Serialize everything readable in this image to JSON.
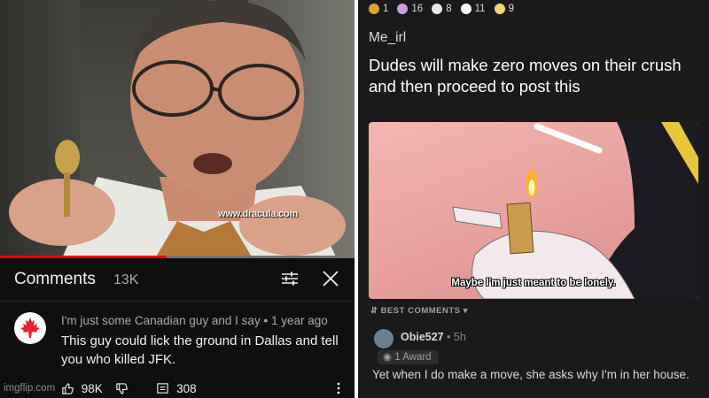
{
  "youtube": {
    "watermark": "www.dracula.com",
    "progress_fraction": 0.47,
    "comments_title": "Comments",
    "comments_count": "13K",
    "comment": {
      "author": "I'm just some Canadian guy and I say",
      "time": "1 year ago",
      "meta_separator": "•",
      "text": "This guy could lick the ground in Dallas and tell you who killed JFK.",
      "likes": "98K",
      "replies": "308"
    },
    "site_watermark": "imgflip.com",
    "icons": {
      "filter": "filter-icon",
      "close": "close-icon",
      "like": "thumbs-up-icon",
      "dislike": "thumbs-down-icon",
      "reply": "reply-icon",
      "more": "more-vert-icon",
      "avatar": "maple-leaf-icon"
    }
  },
  "reddit": {
    "awards": [
      {
        "icon": "award-gold-icon",
        "count": "1",
        "color": "#d9a530"
      },
      {
        "icon": "award-wholesome-icon",
        "count": "16",
        "color": "#c9a0dc"
      },
      {
        "icon": "award-helpful-icon",
        "count": "8",
        "color": "#e8e8e8"
      },
      {
        "icon": "award-silver-icon",
        "count": "11",
        "color": "#ffffff"
      },
      {
        "icon": "award-hugz-icon",
        "count": "9",
        "color": "#f5d76e"
      }
    ],
    "subreddit": "Me_irl",
    "title": "Dudes will make zero moves on their crush and then proceed to post this",
    "image_caption": "Maybe I'm just meant to be lonely.",
    "sort_label": "BEST COMMENTS",
    "comment": {
      "user": "Obie527",
      "time": "5h",
      "meta_separator": "•",
      "award_label": "1 Award",
      "text": "Yet when I do make a move, she asks why I'm in her house."
    }
  },
  "colors": {
    "youtube_bg": "#0f0f0f",
    "reddit_bg": "#1a1a1b",
    "progress_red": "#ff0000",
    "canada_red": "#e3232b"
  }
}
